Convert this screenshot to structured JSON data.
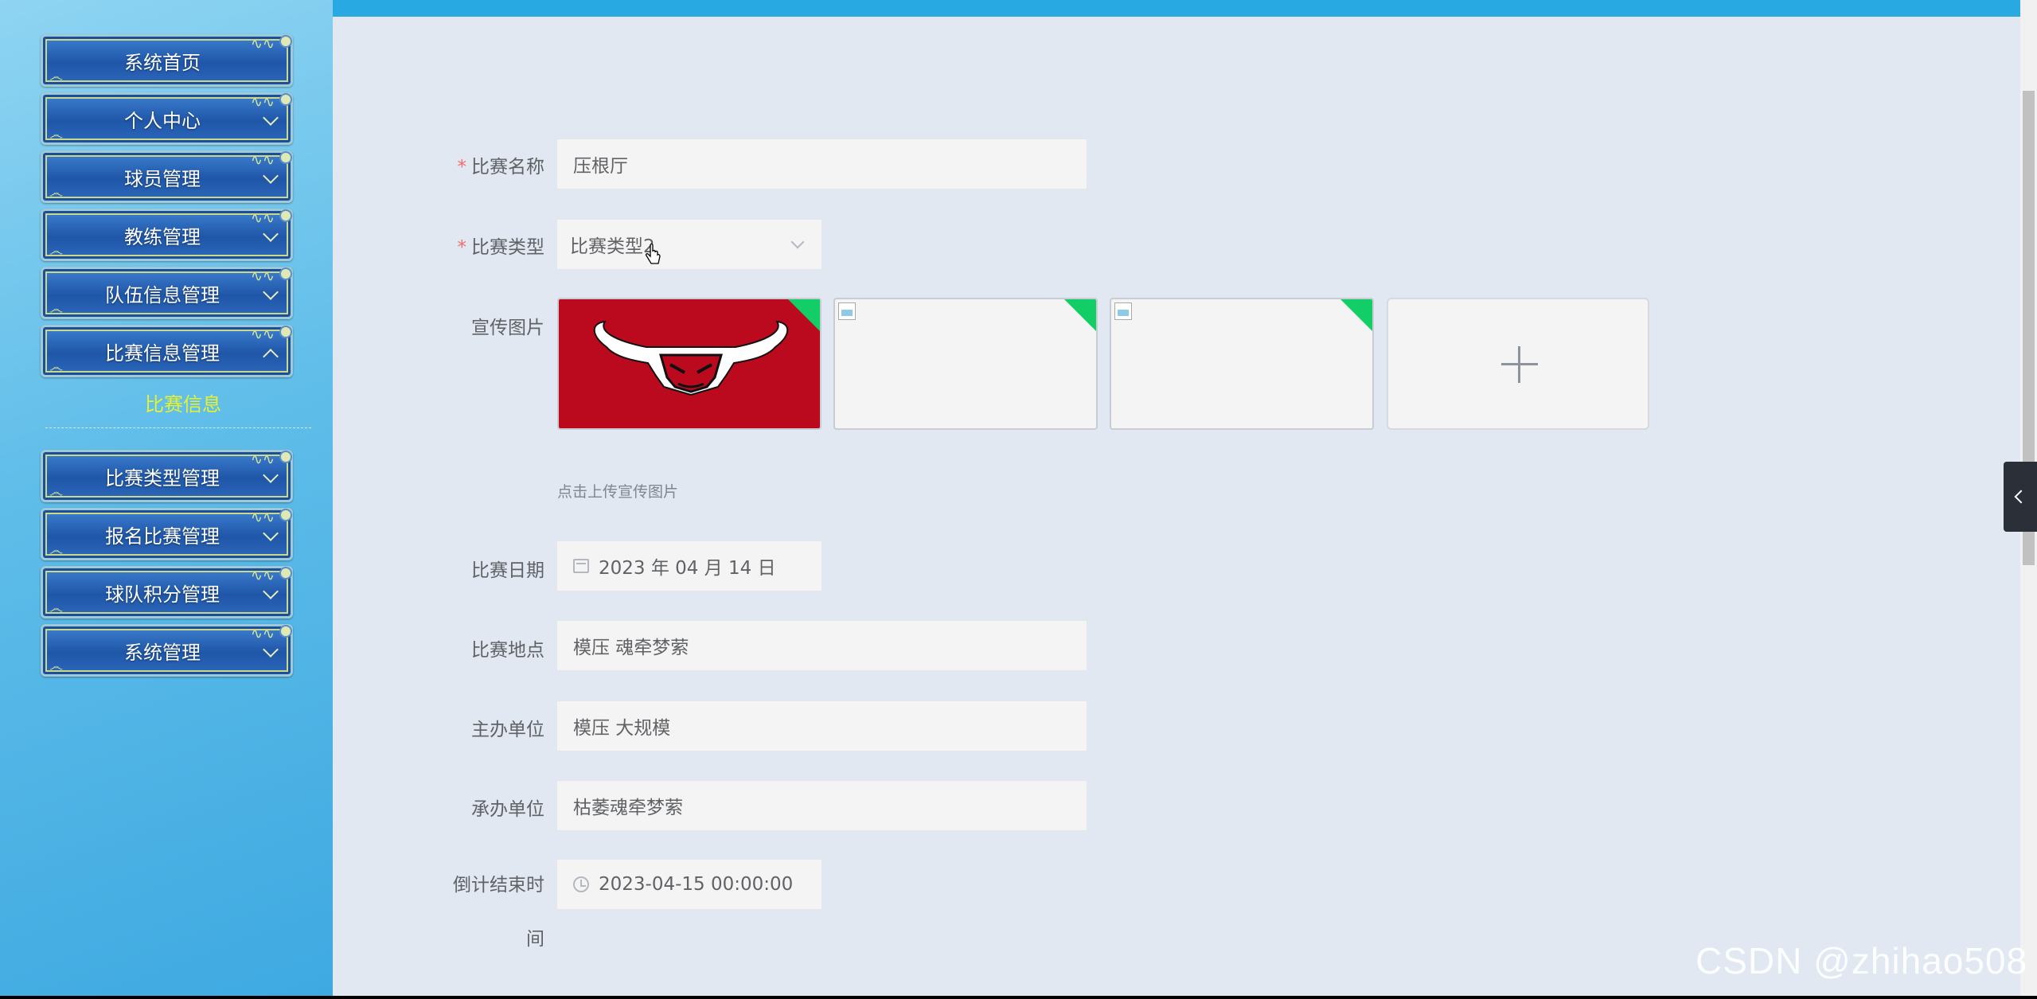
{
  "sidebar": {
    "menu": [
      {
        "label": "系统首页",
        "expand": "none"
      },
      {
        "label": "个人中心",
        "expand": "down"
      },
      {
        "label": "球员管理",
        "expand": "down"
      },
      {
        "label": "教练管理",
        "expand": "down"
      },
      {
        "label": "队伍信息管理",
        "expand": "down"
      },
      {
        "label": "比赛信息管理",
        "expand": "up"
      },
      {
        "label": "比赛类型管理",
        "expand": "down"
      },
      {
        "label": "报名比赛管理",
        "expand": "down"
      },
      {
        "label": "球队积分管理",
        "expand": "down"
      },
      {
        "label": "系统管理",
        "expand": "down"
      }
    ],
    "active_submenu": "比赛信息"
  },
  "form": {
    "name": {
      "label": "比赛名称",
      "required": "*",
      "value": "压根厅"
    },
    "type": {
      "label": "比赛类型",
      "required": "*",
      "value": "比赛类型2"
    },
    "images": {
      "label": "宣传图片",
      "hint": "点击上传宣传图片"
    },
    "date": {
      "label": "比赛日期",
      "value": "2023 年 04 月 14 日"
    },
    "location": {
      "label": "比赛地点",
      "value": "模压 魂牵梦萦"
    },
    "organizer": {
      "label": "主办单位",
      "value": "模压 大规模"
    },
    "co_organizer": {
      "label": "承办单位",
      "value": "枯萎魂牵梦萦"
    },
    "countdown": {
      "label_line1": "倒计结束时",
      "label_line2": "间",
      "value": "2023-04-15 00:00:00"
    }
  },
  "watermark": "CSDN @zhihao508",
  "colors": {
    "accent": "#29a9e1",
    "required": "#f56c6c",
    "upload_success": "#13ce66",
    "submenu_active": "#e6f230"
  }
}
